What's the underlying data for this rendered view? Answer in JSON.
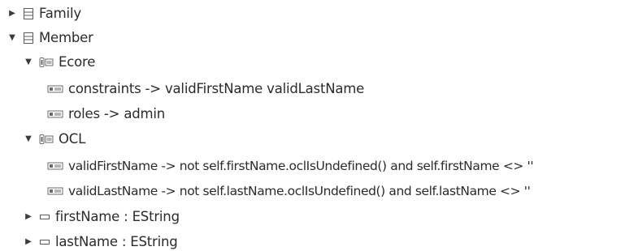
{
  "tree": {
    "family": {
      "label": "Family",
      "icon": "class-icon",
      "expanded": false
    },
    "member": {
      "label": "Member",
      "icon": "class-icon",
      "expanded": true
    },
    "ecore": {
      "label": "Ecore",
      "icon": "annotation-icon",
      "expanded": true
    },
    "ecore_constraints": {
      "label": "constraints -> validFirstName validLastName",
      "icon": "detail-entry-icon"
    },
    "ecore_roles": {
      "label": "roles -> admin",
      "icon": "detail-entry-icon"
    },
    "ocl": {
      "label": "OCL",
      "icon": "annotation-icon",
      "expanded": true
    },
    "ocl_valid_first": {
      "label": "validFirstName -> not self.firstName.oclIsUndefined() and self.firstName <> ''",
      "icon": "detail-entry-icon"
    },
    "ocl_valid_last": {
      "label": "validLastName -> not self.lastName.oclIsUndefined() and self.lastName <> ''",
      "icon": "detail-entry-icon"
    },
    "first_name": {
      "label": "firstName : EString",
      "icon": "attribute-icon",
      "expanded": false
    },
    "last_name": {
      "label": "lastName : EString",
      "icon": "attribute-icon",
      "expanded": false
    }
  },
  "colors": {
    "text": "#2b2b2b",
    "icon_stroke": "#5a5a5a",
    "annotation_icon": "#6b6b6b"
  }
}
